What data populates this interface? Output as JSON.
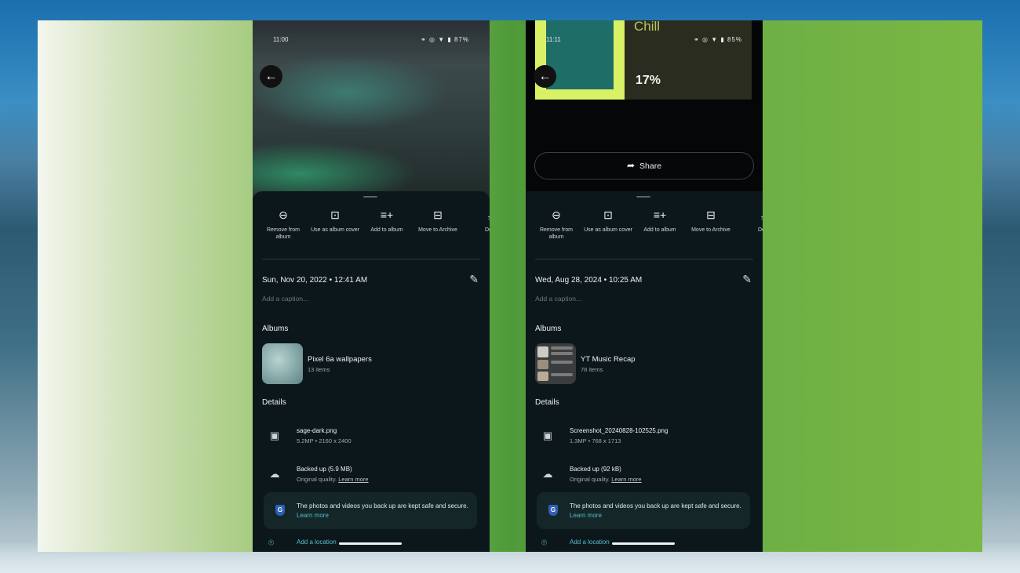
{
  "phones": [
    {
      "status": {
        "time": "11:00",
        "icons": "⚭ ◎ ▼ ▮ 87%"
      },
      "actions": [
        {
          "label": "Remove from album"
        },
        {
          "label": "Use as album cover"
        },
        {
          "label": "Add to album"
        },
        {
          "label": "Move to Archive"
        },
        {
          "label": "Dow"
        }
      ],
      "date": "Sun, Nov 20, 2022  •  12:41 AM",
      "caption_placeholder": "Add a caption...",
      "albums_heading": "Albums",
      "album": {
        "name": "Pixel 6a wallpapers",
        "count": "13 items"
      },
      "details_heading": "Details",
      "file": {
        "name": "sage-dark.png",
        "meta": "5.2MP  •  2160 x 2400"
      },
      "backup": {
        "title": "Backed up (5.9 MB)",
        "quality": "Original quality.",
        "learn_more": "Learn more"
      },
      "safe": {
        "text": "The photos and videos you back up are kept safe and secure.",
        "link": "Learn more"
      },
      "location": "Add a location"
    },
    {
      "status": {
        "time": "11:11",
        "icons": "⚭ ◎ ▼ ▮ 85%"
      },
      "recap": {
        "title": "Chill",
        "percent": "17%"
      },
      "share_label": "Share",
      "actions": [
        {
          "label": "Remove from album"
        },
        {
          "label": "Use as album cover"
        },
        {
          "label": "Add to album"
        },
        {
          "label": "Move to Archive"
        },
        {
          "label": "Dow"
        }
      ],
      "date": "Wed, Aug 28, 2024  •  10:25 AM",
      "caption_placeholder": "Add a caption...",
      "albums_heading": "Albums",
      "album": {
        "name": "YT Music Recap",
        "count": "78 items"
      },
      "details_heading": "Details",
      "file": {
        "name": "Screenshot_20240828-102525.png",
        "meta": "1.3MP  •  768 x 1713"
      },
      "backup": {
        "title": "Backed up (92 kB)",
        "quality": "Original quality.",
        "learn_more": "Learn more"
      },
      "safe": {
        "text": "The photos and videos you back up are kept safe and secure.",
        "link": "Learn more"
      },
      "location": "Add a location"
    }
  ],
  "icons": {
    "back": "arrow-left-icon",
    "actions": [
      "remove-circle-icon",
      "album-cover-icon",
      "playlist-add-icon",
      "archive-icon",
      "download-icon"
    ],
    "edit": "pencil-icon",
    "file": "image-icon",
    "backup": "cloud-done-icon",
    "safe": "google-shield-icon",
    "location": "location-pin-icon",
    "share": "share-arrow-icon"
  },
  "colors": {
    "sheet": "#0c171c",
    "accent": "#56c0c8"
  }
}
